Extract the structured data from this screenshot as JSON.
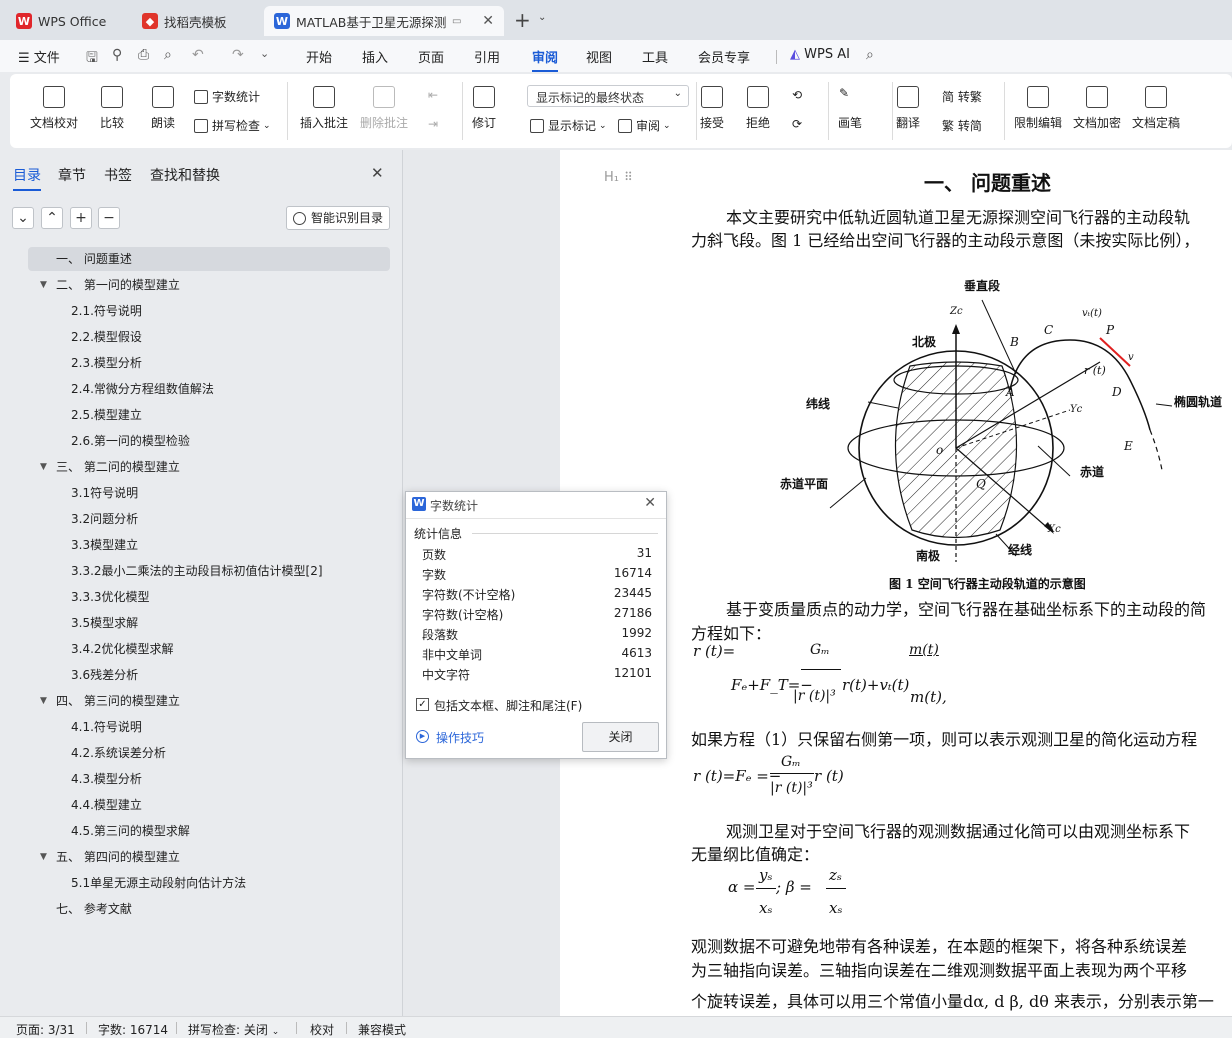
{
  "tabs": {
    "wps": "WPS Office",
    "template": "找稻壳模板",
    "doc": "MATLAB基于卫星无源探测的空"
  },
  "menu": {
    "file": "文件",
    "items": [
      "开始",
      "插入",
      "页面",
      "引用",
      "审阅",
      "视图",
      "工具",
      "会员专享"
    ],
    "ai": "WPS AI"
  },
  "ribbon": {
    "proof": "文档校对",
    "compare": "比较",
    "read": "朗读",
    "wordcount": "字数统计",
    "spell": "拼写检查",
    "insert_comment": "插入批注",
    "delete_comment": "删除批注",
    "revise": "修订",
    "display_state": "显示标记的最终状态",
    "show_marks": "显示标记",
    "review": "审阅",
    "accept": "接受",
    "reject": "拒绝",
    "pen": "画笔",
    "translate": "翻译",
    "to_trad": "简 转繁",
    "to_simp": "繁 转简",
    "restrict": "限制编辑",
    "encrypt": "文档加密",
    "finalize": "文档定稿"
  },
  "sidebar": {
    "tabs": [
      "目录",
      "章节",
      "书签",
      "查找和替换"
    ],
    "smart_btn": "智能识别目录",
    "toc": [
      {
        "t": "一、  问题重述",
        "lv": 0,
        "sel": true
      },
      {
        "t": "二、  第一问的模型建立",
        "lv": 0,
        "exp": true
      },
      {
        "t": "2.1.符号说明",
        "lv": 1
      },
      {
        "t": "2.2.模型假设",
        "lv": 1
      },
      {
        "t": "2.3.模型分析",
        "lv": 1
      },
      {
        "t": "2.4.常微分方程组数值解法",
        "lv": 1
      },
      {
        "t": "2.5.模型建立",
        "lv": 1
      },
      {
        "t": "2.6.第一问的模型检验",
        "lv": 1
      },
      {
        "t": "三、  第二问的模型建立",
        "lv": 0,
        "exp": true
      },
      {
        "t": "3.1符号说明",
        "lv": 1
      },
      {
        "t": "3.2问题分析",
        "lv": 1
      },
      {
        "t": "3.3模型建立",
        "lv": 1
      },
      {
        "t": "3.3.2最小二乘法的主动段目标初值估计模型[2]",
        "lv": 1
      },
      {
        "t": "3.3.3优化模型",
        "lv": 1
      },
      {
        "t": "3.5模型求解",
        "lv": 1
      },
      {
        "t": "3.4.2优化模型求解",
        "lv": 1
      },
      {
        "t": "3.6残差分析",
        "lv": 1
      },
      {
        "t": "四、  第三问的模型建立",
        "lv": 0,
        "exp": true
      },
      {
        "t": "4.1.符号说明",
        "lv": 1
      },
      {
        "t": "4.2.系统误差分析",
        "lv": 1
      },
      {
        "t": "4.3.模型分析",
        "lv": 1
      },
      {
        "t": "4.4.模型建立",
        "lv": 1
      },
      {
        "t": "4.5.第三问的模型求解",
        "lv": 1
      },
      {
        "t": "五、  第四问的模型建立",
        "lv": 0,
        "exp": true
      },
      {
        "t": "5.1单星无源主动段射向估计方法",
        "lv": 1
      },
      {
        "t": "七、  参考文献",
        "lv": 0
      }
    ]
  },
  "doc": {
    "h1": "H₁",
    "heading": "一、  问题重述",
    "p1a": "本文主要研究中低轨近圆轨道卫星无源探测空间飞行器的主动段轨",
    "p1b": "力斜飞段。图 1 已经给出空间飞行器的主动段示意图（未按实际比例），",
    "fig": {
      "vertical": "垂直段",
      "north": "北极",
      "weft": "纬线",
      "equator_plane": "赤道平面",
      "south": "南极",
      "meridian": "经线",
      "equator": "赤道",
      "ellipse": "椭圆轨道",
      "caption": "图 1 空间飞行器主动段轨道的示意图",
      "zc": "Zc",
      "yc": "Yc",
      "xc": "Xc",
      "o": "o",
      "q": "Q",
      "a": "A",
      "b": "B",
      "c": "C",
      "p": "P",
      "d": "D",
      "e": "E",
      "rt": "r (t)",
      "vt": "vₜ(t)",
      "v": "v"
    },
    "p2a": "基于变质量质点的动力学，空间飞行器在基础坐标系下的主动段的简",
    "p2b": "方程如下：",
    "eq1_lhs": "r (t)=",
    "eq1_gm": "Gₘ",
    "eq1_mt": "m(t)",
    "eq1_main": "Fₑ+F_T=−",
    "eq1_den": "|r   (t)|³",
    "eq1_rest": "r(t)+vₜ(t)",
    "eq1_end": "m(t),",
    "p3": "如果方程（1）只保留右侧第一项，则可以表示观测卫星的简化运动方程",
    "eq2_lhs": "r (t)=Fₑ   =−",
    "eq2_num": "Gₘ",
    "eq2_den": "|r   (t)|³",
    "eq2_rest": "r   (t)",
    "p4a": "观测卫星对于空间飞行器的观测数据通过化简可以由观测坐标系下",
    "p4b": "无量纲比值确定：",
    "eq3_a": "α =",
    "eq3_ys": "yₛ",
    "eq3_xs": "xₛ",
    "eq3_mid": ";    β =",
    "eq3_zs": "zₛ",
    "eq3_xs2": "xₛ",
    "p5a": "观测数据不可避免地带有各种误差，在本题的框架下，将各种系统误差",
    "p5b": "为三轴指向误差。三轴指向误差在二维观测数据平面上表现为两个平移",
    "p5c": "个旋转误差，具体可以用三个常值小量dα, d β, dθ 来表示，分别表示第一"
  },
  "dialog": {
    "title": "字数统计",
    "section": "统计信息",
    "rows": [
      {
        "k": "页数",
        "v": "31"
      },
      {
        "k": "字数",
        "v": "16714"
      },
      {
        "k": "字符数(不计空格)",
        "v": "23445"
      },
      {
        "k": "字符数(计空格)",
        "v": "27186"
      },
      {
        "k": "段落数",
        "v": "1992"
      },
      {
        "k": "非中文单词",
        "v": "4613"
      },
      {
        "k": "中文字符",
        "v": "12101"
      }
    ],
    "checkbox": "包括文本框、脚注和尾注(F)",
    "tips": "操作技巧",
    "close": "关闭"
  },
  "status": {
    "page": "页面: 3/31",
    "words": "字数: 16714",
    "spell": "拼写检查: 关闭",
    "proof": "校对",
    "compat": "兼容模式"
  }
}
